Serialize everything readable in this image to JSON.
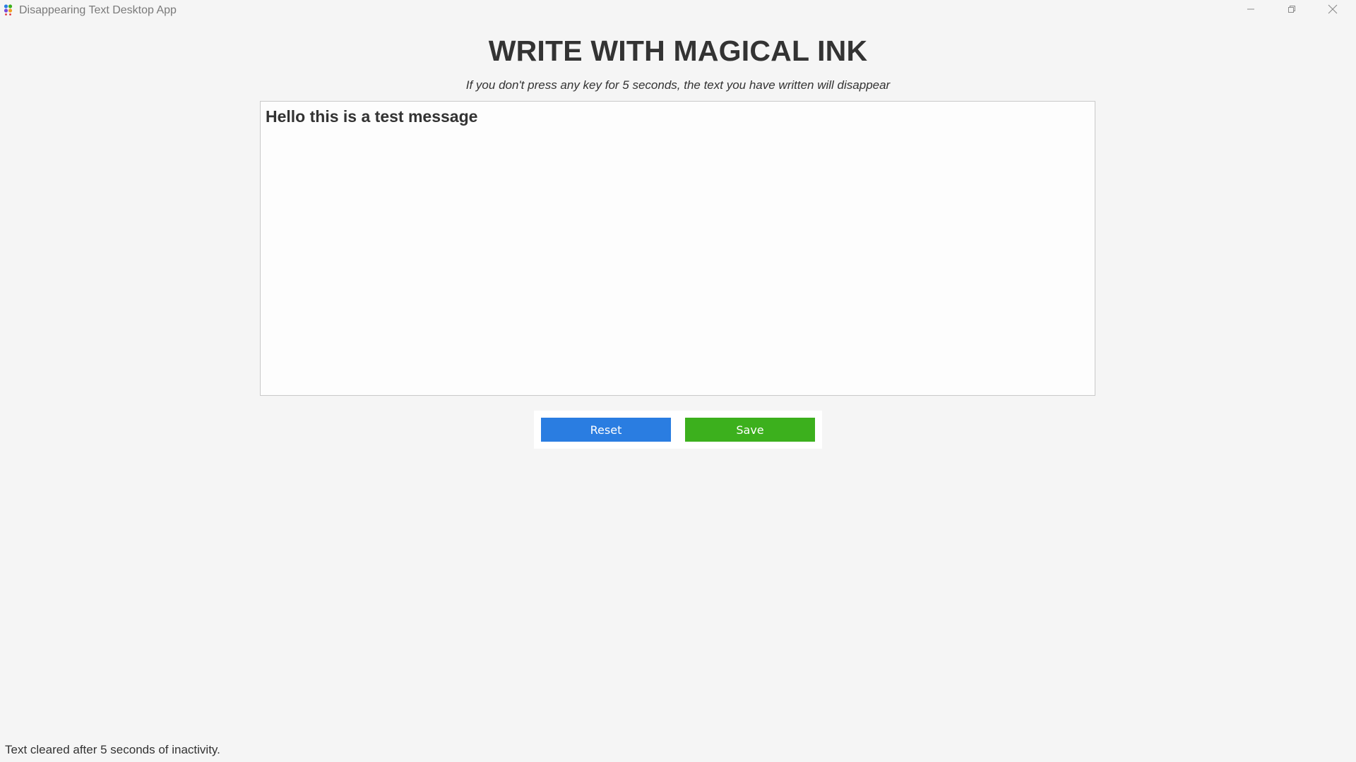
{
  "window": {
    "title": "Disappearing Text Desktop App",
    "app_icon": "colored-dots-app-icon",
    "controls": {
      "minimize_icon": "minimize-icon",
      "maximize_icon": "restore-icon",
      "close_icon": "close-icon"
    }
  },
  "main": {
    "heading": "WRITE WITH MAGICAL INK",
    "subtitle": "If you don't press any key for 5 seconds, the text you have written will disappear",
    "editor_text": "Hello this is a test message"
  },
  "buttons": {
    "reset_label": "Reset",
    "save_label": "Save",
    "reset_color": "#2a7de1",
    "save_color": "#3cb01d"
  },
  "status": {
    "message": "Text cleared after 5 seconds of inactivity."
  }
}
